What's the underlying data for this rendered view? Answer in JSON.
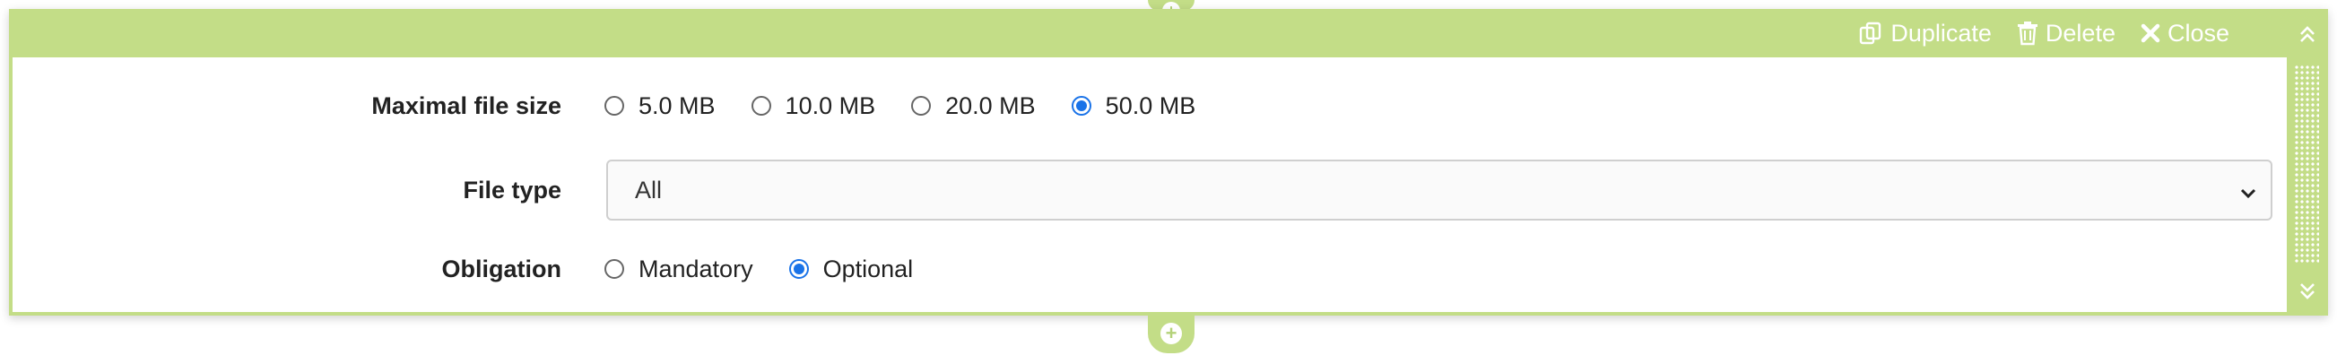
{
  "toolbar": {
    "duplicate_label": "Duplicate",
    "delete_label": "Delete",
    "close_label": "Close"
  },
  "form": {
    "file_size": {
      "label": "Maximal file size",
      "options": [
        "5.0 MB",
        "10.0 MB",
        "20.0 MB",
        "50.0 MB"
      ],
      "selected": "50.0 MB"
    },
    "file_type": {
      "label": "File type",
      "value": "All"
    },
    "obligation": {
      "label": "Obligation",
      "options": [
        "Mandatory",
        "Optional"
      ],
      "selected": "Optional"
    }
  },
  "colors": {
    "panel": "#c3dd87",
    "radio_checked": "#1a73e8"
  }
}
